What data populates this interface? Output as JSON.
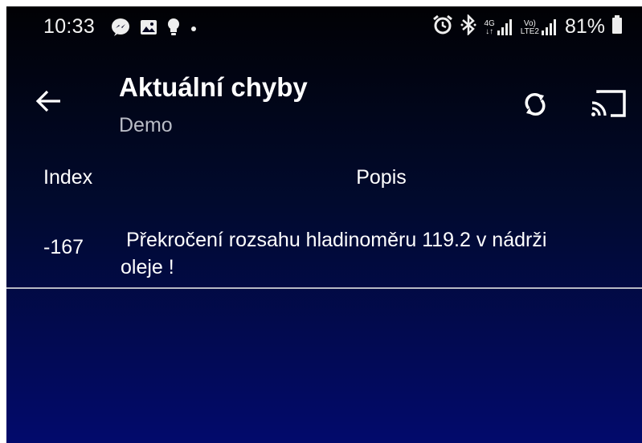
{
  "status_bar": {
    "time": "10:33",
    "left_icons": [
      "messenger-icon",
      "image-icon",
      "bulb-icon",
      "dot-icon"
    ],
    "right_icons": [
      "alarm-icon",
      "bluetooth-icon",
      "signal-4g-icon",
      "volte-signal-icon",
      "battery-icon"
    ],
    "network_top": "4G",
    "network_bottom": "↓↑",
    "volte_top": "Vo)",
    "volte_bottom": "LTE2",
    "battery_percent": "81%"
  },
  "app_bar": {
    "title": "Aktuální chyby",
    "subtitle": "Demo",
    "back_icon": "arrow-left-icon",
    "refresh_icon": "refresh-icon",
    "cast_icon": "cast-icon"
  },
  "table": {
    "columns": [
      "Index",
      "Popis"
    ],
    "rows": [
      {
        "index": "-167",
        "popis": " Překročení rozsahu hladinoměru 119.2 v nádrži\noleje !"
      }
    ]
  },
  "colors": {
    "background_top": "#010104",
    "background_bottom": "#020a6c",
    "text": "#ffffff",
    "subtitle": "#b9bcc6",
    "divider": "#b7b9c4"
  }
}
